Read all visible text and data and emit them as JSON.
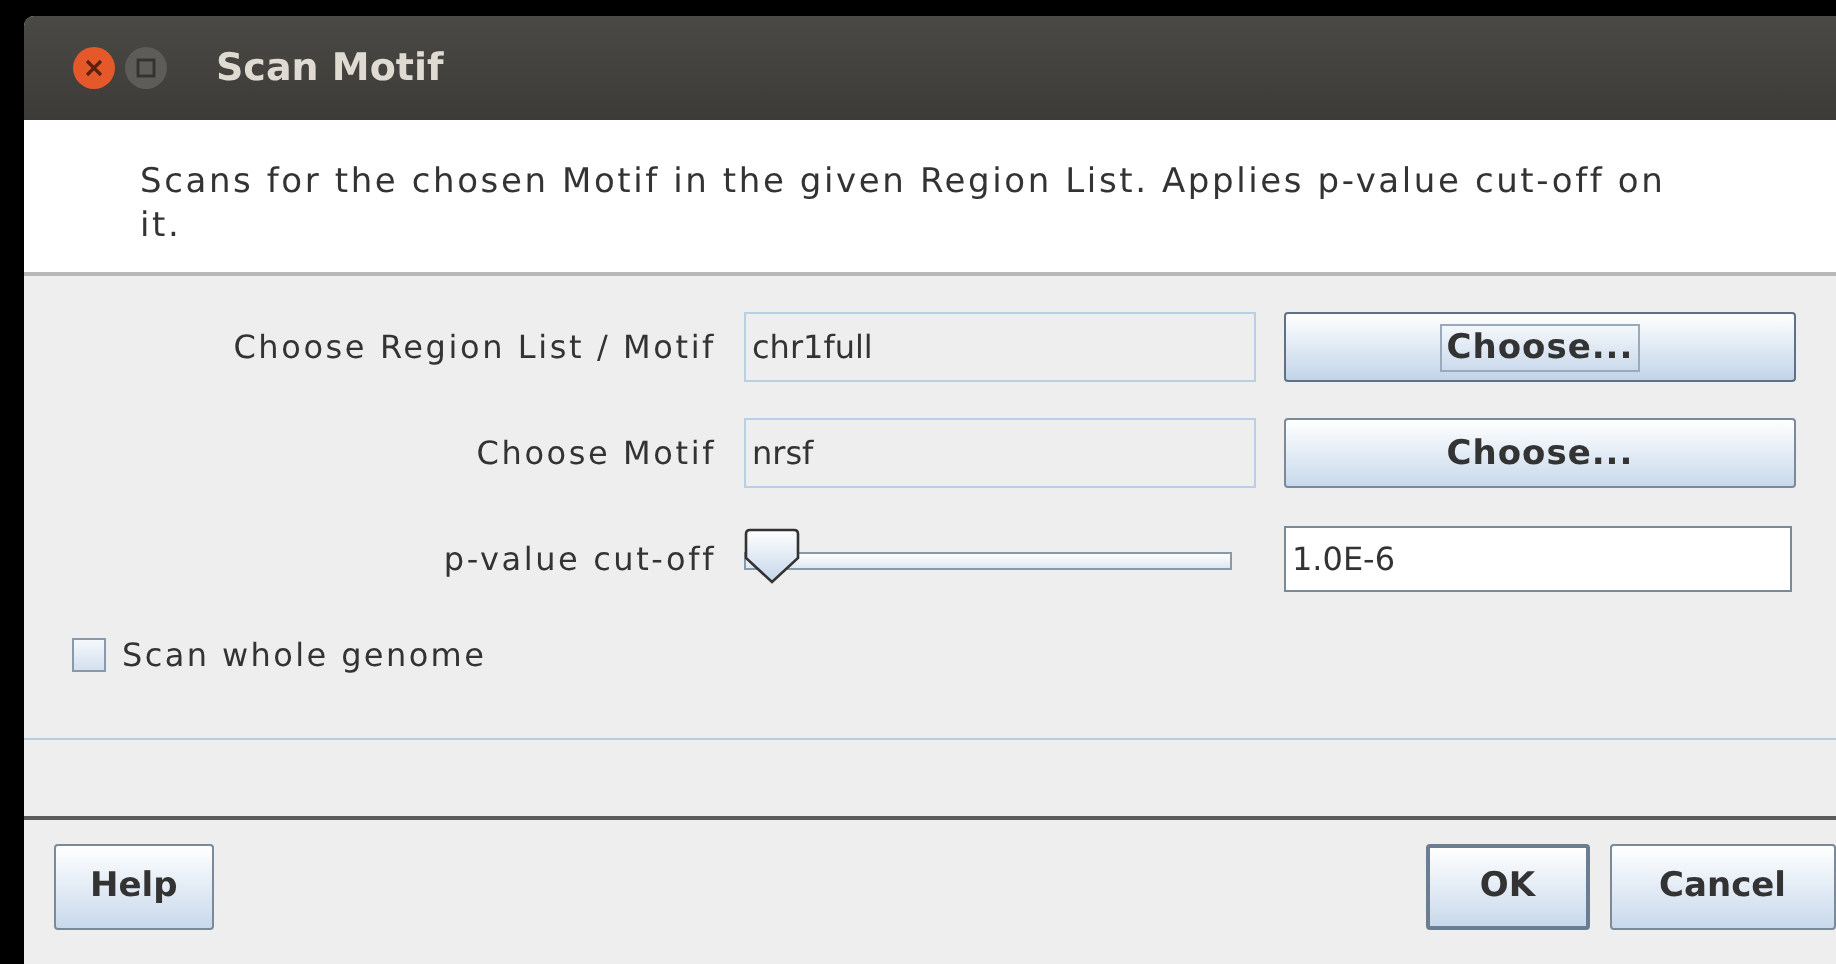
{
  "window": {
    "title": "Scan Motif"
  },
  "description": "Scans for the chosen Motif in the given Region List. Applies p-value cut-off on it.",
  "rows": [
    {
      "kind": "chooser",
      "label": "Choose Region List / Motif",
      "value": "chr1full",
      "button": {
        "label": "Choose...",
        "focused": true
      }
    },
    {
      "kind": "chooser",
      "label": "Choose Motif",
      "value": "nrsf",
      "button": {
        "label": "Choose...",
        "focused": false
      }
    },
    {
      "kind": "slider",
      "label": "p-value cut-off",
      "level": 0,
      "value": "1.0E-6"
    }
  ],
  "checkbox": {
    "label": "Scan whole genome",
    "checked": false
  },
  "left_buttons": [
    {
      "label": "Help",
      "default": false
    }
  ],
  "right_buttons": [
    {
      "label": "OK",
      "default": true
    },
    {
      "label": "Cancel",
      "default": false
    }
  ]
}
